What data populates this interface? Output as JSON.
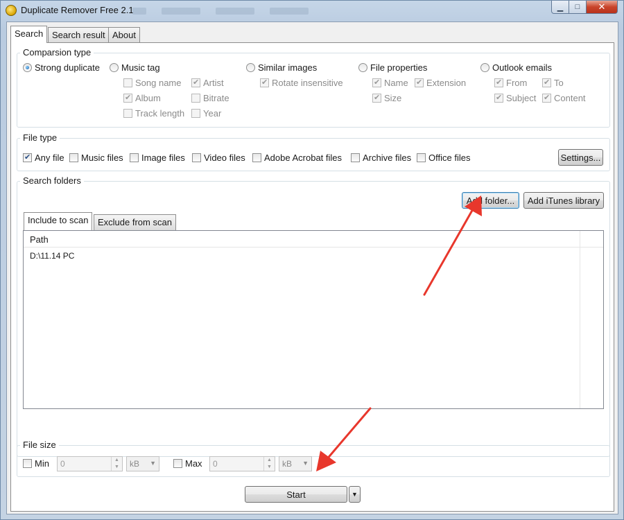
{
  "window": {
    "title": "Duplicate Remover Free 2.1",
    "caption_buttons": {
      "minimize": "▁",
      "maximize": "□",
      "close": "✕"
    }
  },
  "tabs": [
    {
      "label": "Search",
      "active": true
    },
    {
      "label": "Search result",
      "active": false
    },
    {
      "label": "About",
      "active": false
    }
  ],
  "comparison": {
    "legend": "Comparsion type",
    "strong_duplicate": "Strong duplicate",
    "music_tag": "Music tag",
    "music_options": [
      "Song name",
      "Artist",
      "Album",
      "Bitrate",
      "Track length",
      "Year"
    ],
    "similar_images": "Similar images",
    "rotate_insensitive": "Rotate insensitive",
    "file_properties": "File properties",
    "file_prop_options": [
      "Name",
      "Extension",
      "Size"
    ],
    "outlook_emails": "Outlook emails",
    "outlook_options": [
      "From",
      "To",
      "Subject",
      "Content"
    ]
  },
  "file_type": {
    "legend": "File type",
    "options": [
      "Any file",
      "Music files",
      "Image files",
      "Video files",
      "Adobe Acrobat files",
      "Archive files",
      "Office files"
    ],
    "settings_button": "Settings..."
  },
  "search_folders": {
    "legend": "Search folders",
    "add_folder_button": "Add folder...",
    "add_itunes_button": "Add iTunes library",
    "tabs": [
      "Include to scan",
      "Exclude from scan"
    ],
    "column_path": "Path",
    "rows": [
      "D:\\11.14 PC"
    ]
  },
  "file_size": {
    "legend": "File size",
    "min_label": "Min",
    "min_value": "0",
    "min_unit": "kB",
    "max_label": "Max",
    "max_value": "0",
    "max_unit": "kB"
  },
  "start_button": "Start",
  "colors": {
    "annotation_arrow": "#e8372c",
    "focus_border": "#3c7fb1"
  }
}
